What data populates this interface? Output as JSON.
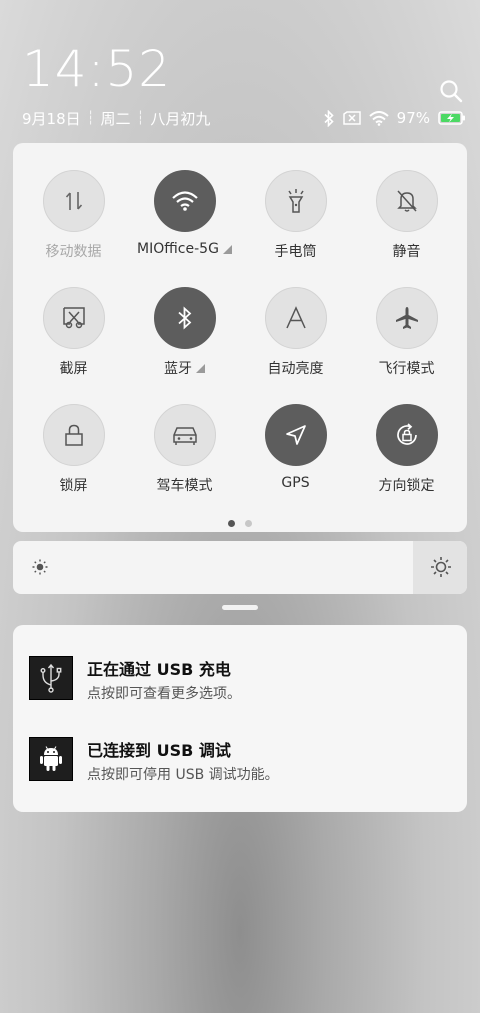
{
  "status": {
    "time": "14:52",
    "date": "9月18日",
    "weekday": "周二",
    "lunar": "八月初九",
    "battery": "97%",
    "icons": [
      "bluetooth-icon",
      "no-sim-icon",
      "wifi-icon",
      "battery-charging-icon"
    ]
  },
  "quick_settings": {
    "tiles": [
      {
        "label": "移动数据",
        "icon": "mobile-data-icon",
        "state": "unavailable"
      },
      {
        "label": "MIOffice-5G",
        "icon": "wifi-icon",
        "state": "on",
        "has_detail": true
      },
      {
        "label": "手电筒",
        "icon": "flashlight-icon",
        "state": "off"
      },
      {
        "label": "静音",
        "icon": "bell-off-icon",
        "state": "off"
      },
      {
        "label": "截屏",
        "icon": "screenshot-icon",
        "state": "off"
      },
      {
        "label": "蓝牙",
        "icon": "bluetooth-icon",
        "state": "on",
        "has_detail": true
      },
      {
        "label": "自动亮度",
        "icon": "auto-brightness-icon",
        "state": "off"
      },
      {
        "label": "飞行模式",
        "icon": "airplane-icon",
        "state": "off"
      },
      {
        "label": "锁屏",
        "icon": "lock-icon",
        "state": "off"
      },
      {
        "label": "驾车模式",
        "icon": "car-icon",
        "state": "off"
      },
      {
        "label": "GPS",
        "icon": "location-icon",
        "state": "on"
      },
      {
        "label": "方向锁定",
        "icon": "rotation-lock-icon",
        "state": "on"
      }
    ],
    "pages": 2,
    "current_page": 1
  },
  "brightness": {
    "level": 0.91
  },
  "notifications": [
    {
      "title": "正在通过 USB 充电",
      "body": "点按即可查看更多选项。",
      "icon": "usb-icon"
    },
    {
      "title": "已连接到 USB 调试",
      "body": "点按即可停用 USB 调试功能。",
      "icon": "android-icon"
    }
  ]
}
